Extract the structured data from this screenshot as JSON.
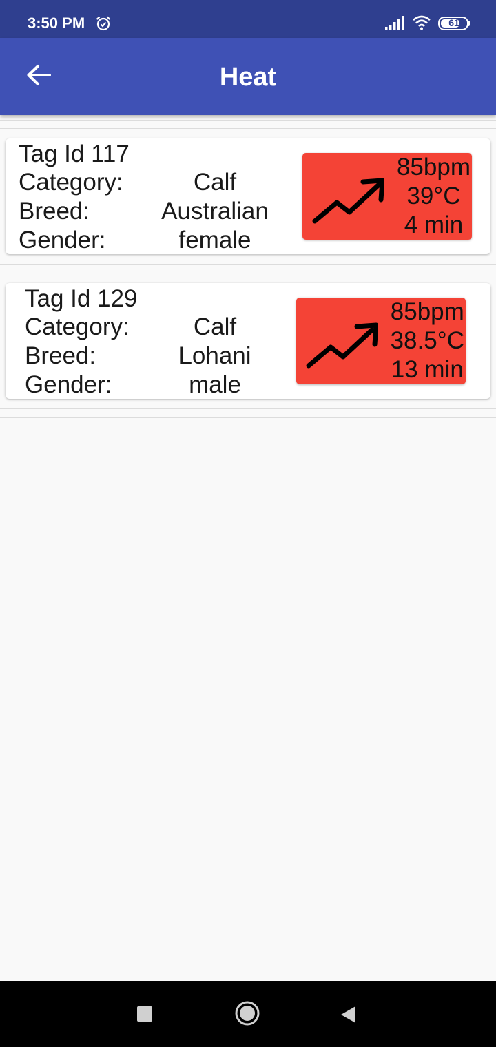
{
  "status_bar": {
    "time": "3:50 PM",
    "battery": "61",
    "icons": [
      "alarm-icon",
      "signal-icon",
      "wifi-icon",
      "battery-icon"
    ]
  },
  "app_bar": {
    "title": "Heat",
    "back_icon": "arrow-left-icon"
  },
  "labels": {
    "category": "Category:",
    "breed": "Breed:",
    "gender": "Gender:"
  },
  "cards": [
    {
      "tag": "Tag Id 117",
      "category": "Calf",
      "breed": "Australian",
      "gender": "female",
      "heart_rate": "85bpm",
      "temperature": "39°C",
      "duration": "4 min",
      "alert_icon": "trending-up-icon"
    },
    {
      "tag": "Tag Id 129",
      "category": "Calf",
      "breed": "Lohani",
      "gender": "male",
      "heart_rate": "85bpm",
      "temperature": "38.5°C",
      "duration": "13 min",
      "alert_icon": "trending-up-icon"
    }
  ],
  "colors": {
    "status_bar": "#2f3f8f",
    "app_bar": "#3f51b5",
    "alert": "#f44336",
    "background": "#f9f9f9"
  },
  "nav_bar": {
    "icons": [
      "recents-square-icon",
      "home-circle-icon",
      "back-triangle-icon"
    ]
  }
}
